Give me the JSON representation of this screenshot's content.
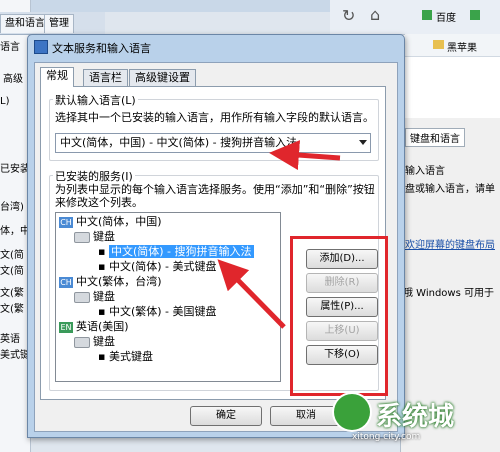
{
  "background": {
    "left_tabs": [
      "盘和语言",
      "管理"
    ],
    "left_labels": [
      "语言",
      "高级",
      "L)",
      "已安装",
      "台湾)",
      "体，中",
      "文(简",
      "文(简",
      "文(繁",
      "文(繁",
      "英语",
      "美式键"
    ],
    "browser": {
      "bookmark_label": "百度",
      "folder_label": "黑苹果",
      "right_tab": "键盘和语言"
    },
    "right_labels": [
      "输入语言",
      "盘或输入语言，请单",
      "欢迎屏幕的键盘布局",
      "哦 Windows 可用于"
    ]
  },
  "dialog": {
    "title": "文本服务和输入语言",
    "tabs": [
      "常规",
      "语言栏",
      "高级键设置"
    ],
    "default_group": {
      "label": "默认输入语言(L)",
      "description": "选择其中一个已安装的输入语言，用作所有输入字段的默认语言。",
      "selected": "中文(简体，中国) - 中文(简体) - 搜狗拼音输入法"
    },
    "installed_group": {
      "label": "已安装的服务(I)",
      "description": "为列表中显示的每个输入语言选择服务。使用“添加”和“删除”按钮来修改这个列表。",
      "tree": [
        {
          "type": "lang",
          "code": "CH",
          "text": "中文(简体，中国)"
        },
        {
          "type": "kb",
          "text": "键盘"
        },
        {
          "type": "item",
          "text": "中文(简体) - 搜狗拼音输入法",
          "selected": true
        },
        {
          "type": "item",
          "text": "中文(简体) - 美式键盘"
        },
        {
          "type": "lang",
          "code": "CH",
          "text": "中文(繁体，台湾)"
        },
        {
          "type": "kb",
          "text": "键盘"
        },
        {
          "type": "item",
          "text": "中文(繁体) - 美国键盘"
        },
        {
          "type": "lang",
          "code": "EN",
          "text": "英语(美国)"
        },
        {
          "type": "kb",
          "text": "键盘"
        },
        {
          "type": "item",
          "text": "美式键盘"
        }
      ],
      "buttons": {
        "add": "添加(D)...",
        "remove": "删除(R)",
        "properties": "属性(P)...",
        "move_up": "上移(U)",
        "move_down": "下移(O)"
      }
    },
    "footer": {
      "ok": "确定",
      "cancel": "取消"
    }
  },
  "watermark": {
    "brand": "系统城",
    "url": "xitong city.com"
  },
  "colors": {
    "annotation_red": "#e0262c",
    "selection": "#3399ff",
    "title_bar": "#b9d1ea"
  }
}
